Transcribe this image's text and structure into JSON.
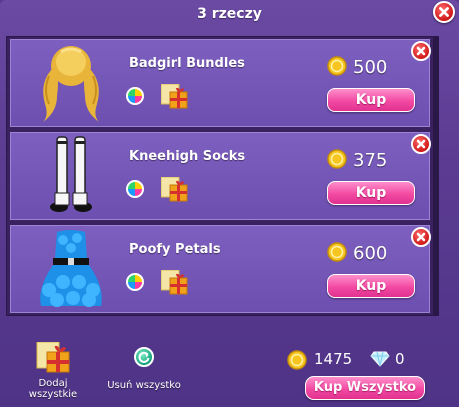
{
  "header": {
    "title": "3 rzeczy"
  },
  "items": [
    {
      "name": "Badgirl Bundles",
      "price": "500",
      "buy_label": "Kup",
      "thumb_icon": "blonde-pigtails-hair-icon"
    },
    {
      "name": "Kneehigh Socks",
      "price": "375",
      "buy_label": "Kup",
      "thumb_icon": "kneehigh-socks-icon"
    },
    {
      "name": "Poofy Petals",
      "price": "600",
      "buy_label": "Kup",
      "thumb_icon": "blue-tutu-dress-icon"
    }
  ],
  "footer": {
    "add_all_label": "Dodaj wszystkie",
    "remove_all_label": "Usuń wszystko",
    "coins": "1475",
    "diamonds": "0",
    "buy_all_label": "Kup Wszystko"
  },
  "colors": {
    "accent_pink": "#f24aa3",
    "panel_purple": "#6b4aa3",
    "close_red": "#d01818"
  }
}
